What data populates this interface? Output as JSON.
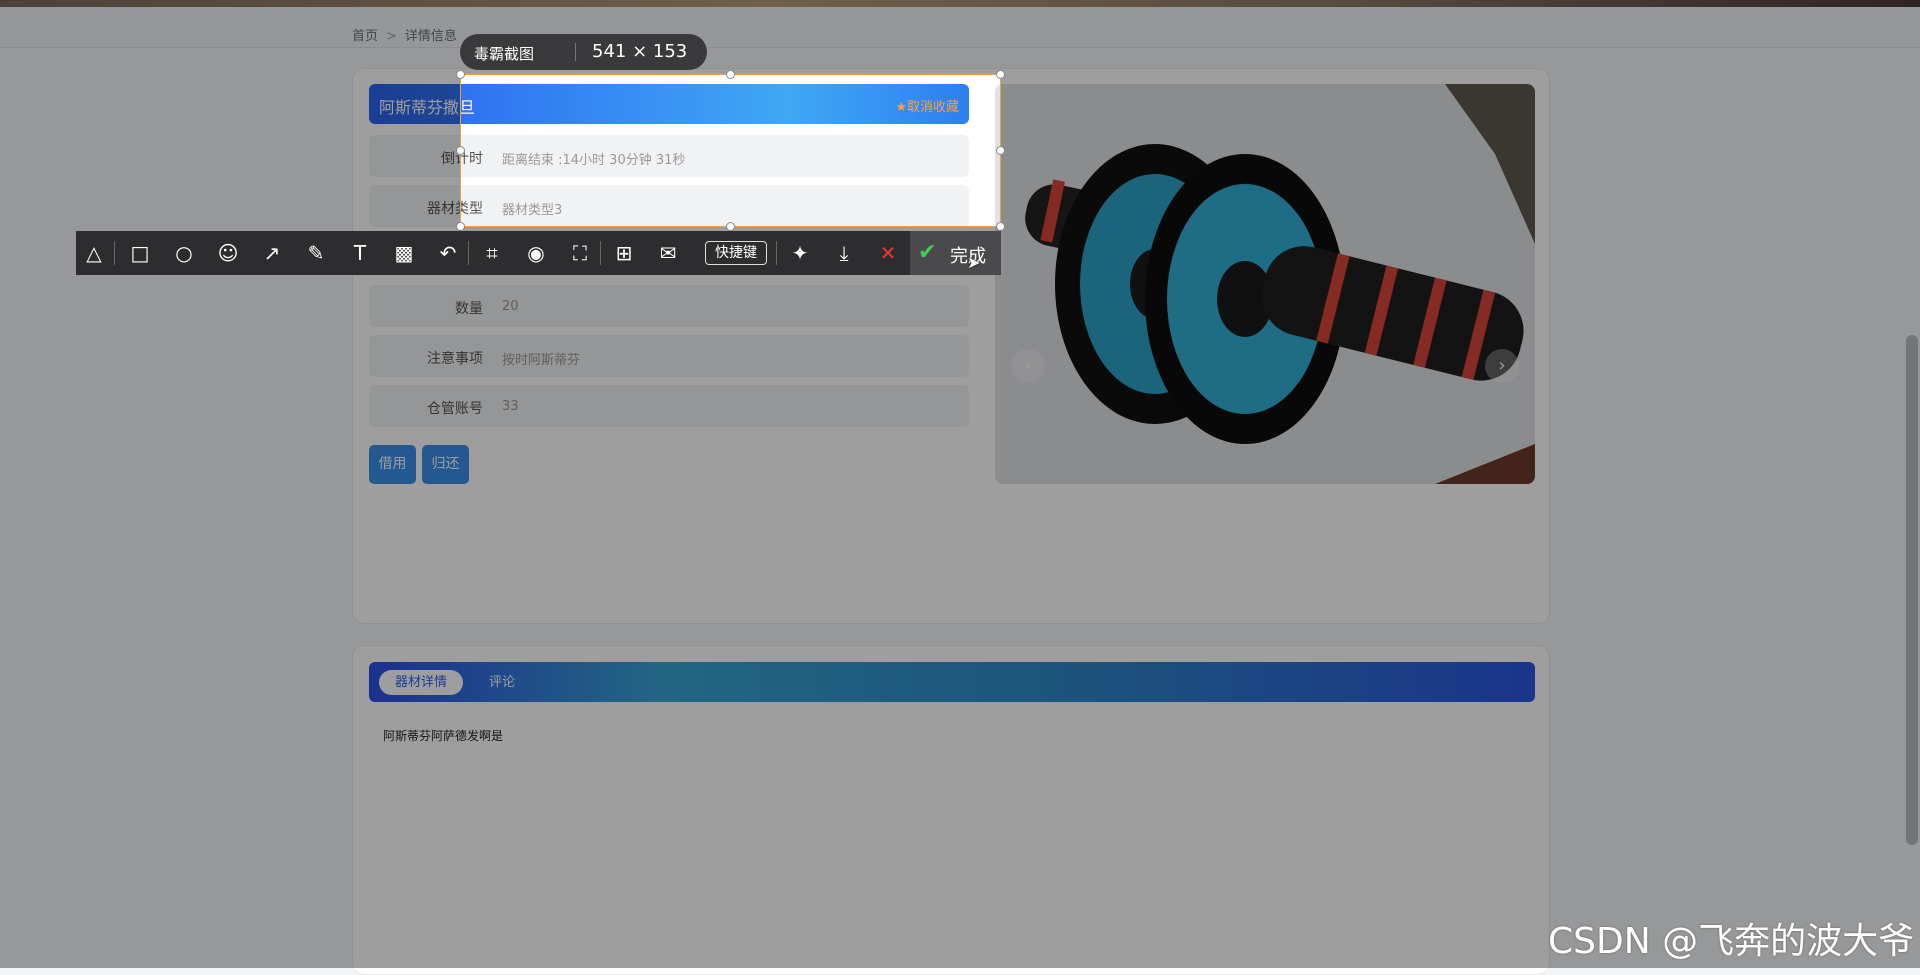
{
  "breadcrumb": {
    "home": "首页",
    "separator": ">",
    "current": "详情信息"
  },
  "product": {
    "name": "阿斯蒂芬撒旦",
    "favorite_label": "★取消收藏",
    "fields": [
      {
        "label": "倒计时",
        "value": "距离结束 :14小时 30分钟 31秒"
      },
      {
        "label": "器材类型",
        "value": "器材类型3"
      },
      {
        "label": "数量",
        "value": "20"
      },
      {
        "label": "注意事项",
        "value": "按时阿斯蒂芬"
      },
      {
        "label": "仓管账号",
        "value": "33"
      }
    ],
    "buttons": {
      "borrow": "借用",
      "return": "归还"
    }
  },
  "carousel": {
    "image": "ab-roller-wheel",
    "prev": "‹",
    "next": "›"
  },
  "tabs": [
    {
      "label": "器材详情",
      "active": true
    },
    {
      "label": "评论",
      "active": false
    }
  ],
  "detail_text": "阿斯蒂芬阿萨德发啊是",
  "screenshot_tool": {
    "app_name": "毒霸截图",
    "dimensions": "541 × 153",
    "shortcut_label": "快捷键",
    "done_label": "完成"
  },
  "watermark": "CSDN @飞奔的波大爷",
  "colors": {
    "accent": "#2d62ef",
    "favorite": "#ff9c3a",
    "done_check": "#3dcf52",
    "cancel": "#e53935"
  }
}
